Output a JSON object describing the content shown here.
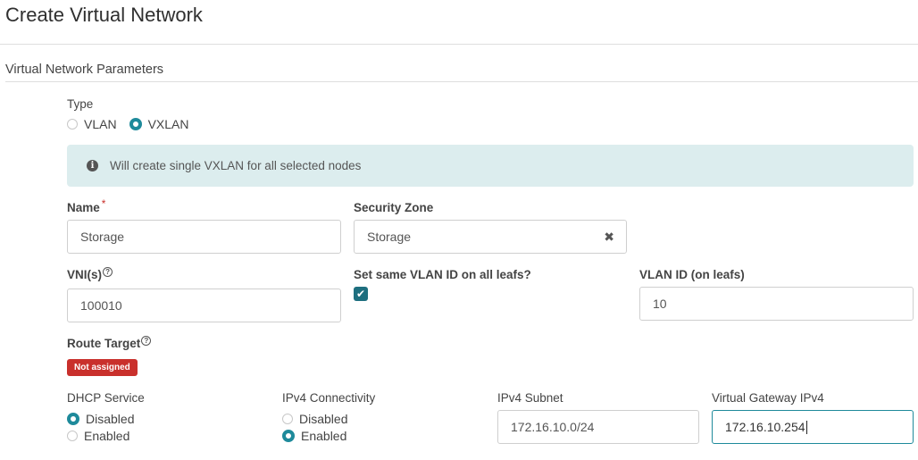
{
  "page": {
    "title": "Create Virtual Network"
  },
  "section": {
    "title": "Virtual Network Parameters"
  },
  "type": {
    "label": "Type",
    "options": [
      {
        "label": "VLAN",
        "selected": false
      },
      {
        "label": "VXLAN",
        "selected": true
      }
    ]
  },
  "info": {
    "text": "Will create single VXLAN for all selected nodes",
    "icon": "info-circle-icon"
  },
  "name": {
    "label": "Name",
    "required_mark": "*",
    "value": "Storage"
  },
  "security_zone": {
    "label": "Security Zone",
    "value": "Storage",
    "clear_symbol": "✖"
  },
  "vni": {
    "label": "VNI(s)",
    "help_symbol": "?",
    "value": "100010"
  },
  "same_vlan": {
    "label": "Set same VLAN ID on all leafs?",
    "checked": true,
    "check_symbol": "✔"
  },
  "vlan_id": {
    "label": "VLAN ID (on leafs)",
    "value": "10"
  },
  "route_target": {
    "label": "Route Target",
    "help_symbol": "?",
    "badge": "Not assigned"
  },
  "dhcp": {
    "label": "DHCP Service",
    "options": [
      {
        "label": "Disabled",
        "selected": true
      },
      {
        "label": "Enabled",
        "selected": false
      }
    ]
  },
  "ipv4_connectivity": {
    "label": "IPv4 Connectivity",
    "options": [
      {
        "label": "Disabled",
        "selected": false
      },
      {
        "label": "Enabled",
        "selected": true
      }
    ]
  },
  "ipv4_subnet": {
    "label": "IPv4 Subnet",
    "value": "172.16.10.0/24"
  },
  "virtual_gateway": {
    "label": "Virtual Gateway IPv4",
    "value": "172.16.10.254"
  },
  "colors": {
    "accent": "#1e8a9b",
    "checkbox": "#1e6f7f",
    "badge": "#c9302c",
    "info_bg": "#dcedee"
  }
}
